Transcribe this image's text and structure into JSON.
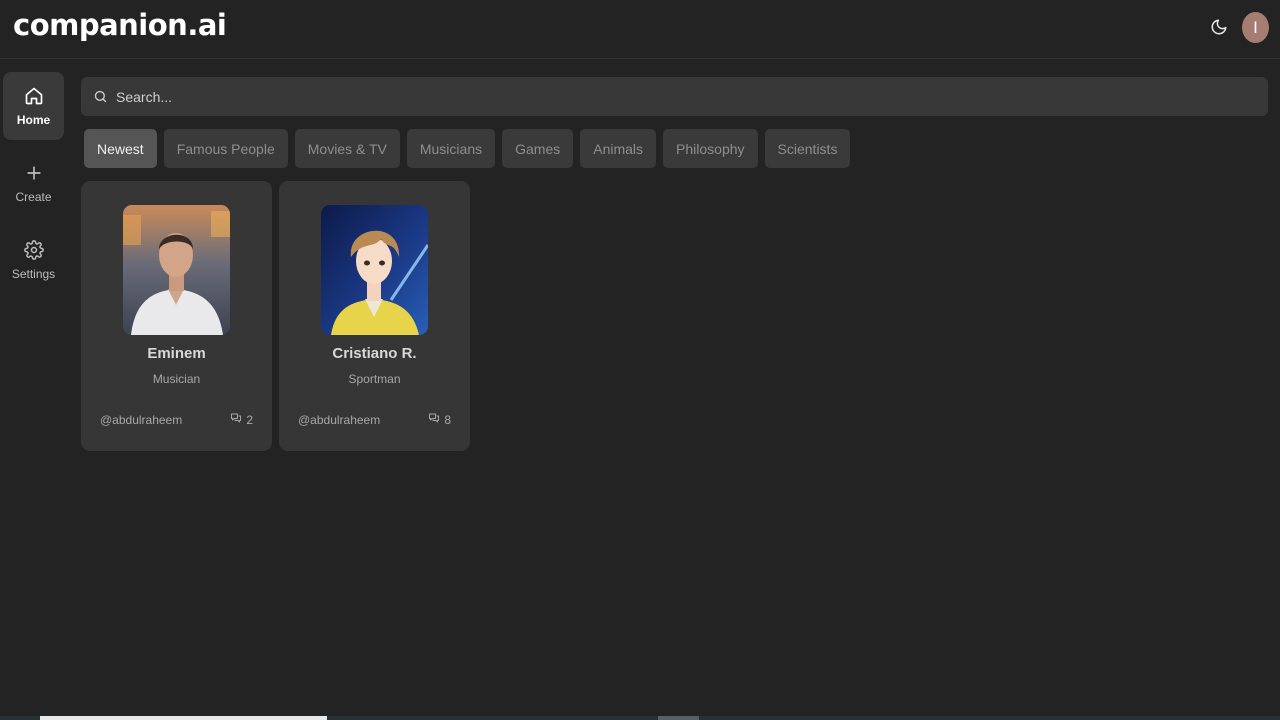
{
  "header": {
    "logo": "companion.ai",
    "theme_icon": "moon-icon",
    "avatar_initial": "I",
    "avatar_color": "#a57d72"
  },
  "sidebar": {
    "items": [
      {
        "label": "Home",
        "icon": "home-icon",
        "active": true
      },
      {
        "label": "Create",
        "icon": "plus-icon",
        "active": false
      },
      {
        "label": "Settings",
        "icon": "gear-icon",
        "active": false
      }
    ]
  },
  "search": {
    "placeholder": "Search...",
    "value": ""
  },
  "categories": [
    {
      "label": "Newest",
      "active": true
    },
    {
      "label": "Famous People",
      "active": false
    },
    {
      "label": "Movies & TV",
      "active": false
    },
    {
      "label": "Musicians",
      "active": false
    },
    {
      "label": "Games",
      "active": false
    },
    {
      "label": "Animals",
      "active": false
    },
    {
      "label": "Philosophy",
      "active": false
    },
    {
      "label": "Scientists",
      "active": false
    }
  ],
  "companions": [
    {
      "name": "Eminem",
      "description": "Musician",
      "author": "@abdulraheem",
      "messages": "2",
      "image": "man-in-white-shirt-photo"
    },
    {
      "name": "Cristiano R.",
      "description": "Sportman",
      "author": "@abdulraheem",
      "messages": "8",
      "image": "anime-character-portrait"
    }
  ],
  "colors": {
    "background": "#232323",
    "card": "#363636",
    "chip": "#3a3a3a",
    "chip_active": "#555555"
  }
}
